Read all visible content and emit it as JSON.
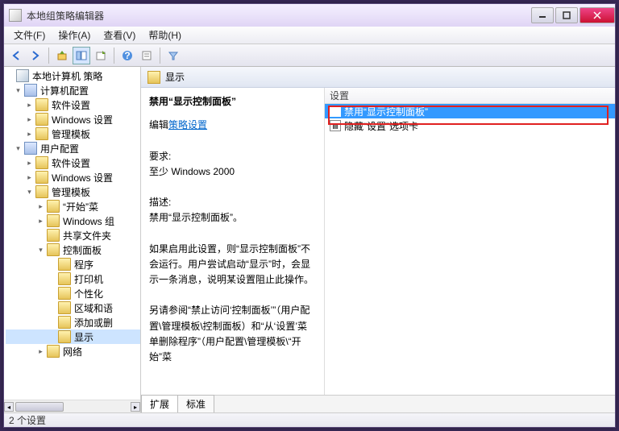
{
  "window": {
    "title": "本地组策略编辑器"
  },
  "menu": {
    "file": "文件(F)",
    "action": "操作(A)",
    "view": "查看(V)",
    "help": "帮助(H)"
  },
  "tree": {
    "root": "本地计算机 策略",
    "computer_config": "计算机配置",
    "cc_software": "软件设置",
    "cc_windows": "Windows 设置",
    "cc_admin": "管理模板",
    "user_config": "用户配置",
    "uc_software": "软件设置",
    "uc_windows": "Windows 设置",
    "uc_admin": "管理模板",
    "start_menu": "“开始”菜",
    "windows_comp": "Windows 组",
    "shared_folders": "共享文件夹",
    "control_panel": "控制面板",
    "cp_programs": "程序",
    "cp_printers": "打印机",
    "cp_personalization": "个性化",
    "cp_region": "区域和语",
    "cp_addremove": "添加或删",
    "cp_display": "显示",
    "network": "网络"
  },
  "content": {
    "header": "显示",
    "policy_title": "禁用“显示控制面板”",
    "edit_prefix": "编辑",
    "edit_link": "策略设置",
    "req_label": "要求:",
    "req_value": "至少 Windows 2000",
    "desc_label": "描述:",
    "desc_1": "禁用“显示控制面板”。",
    "desc_2": "如果启用此设置，则“显示控制面板”不会运行。用户尝试启动“显示”时，会显示一条消息，说明某设置阻止此操作。",
    "desc_3": "另请参阅“禁止访问‘控制面板’”（用户配置\\管理模板\\控制面板）和“从‘设置’菜单删除程序”（用户配置\\管理模板\\“开始”菜",
    "list_header": "设置",
    "item_1": "禁用“显示控制面板”",
    "item_2": "隐藏“设置”选项卡"
  },
  "tabs": {
    "extended": "扩展",
    "standard": "标准"
  },
  "status": "2 个设置"
}
